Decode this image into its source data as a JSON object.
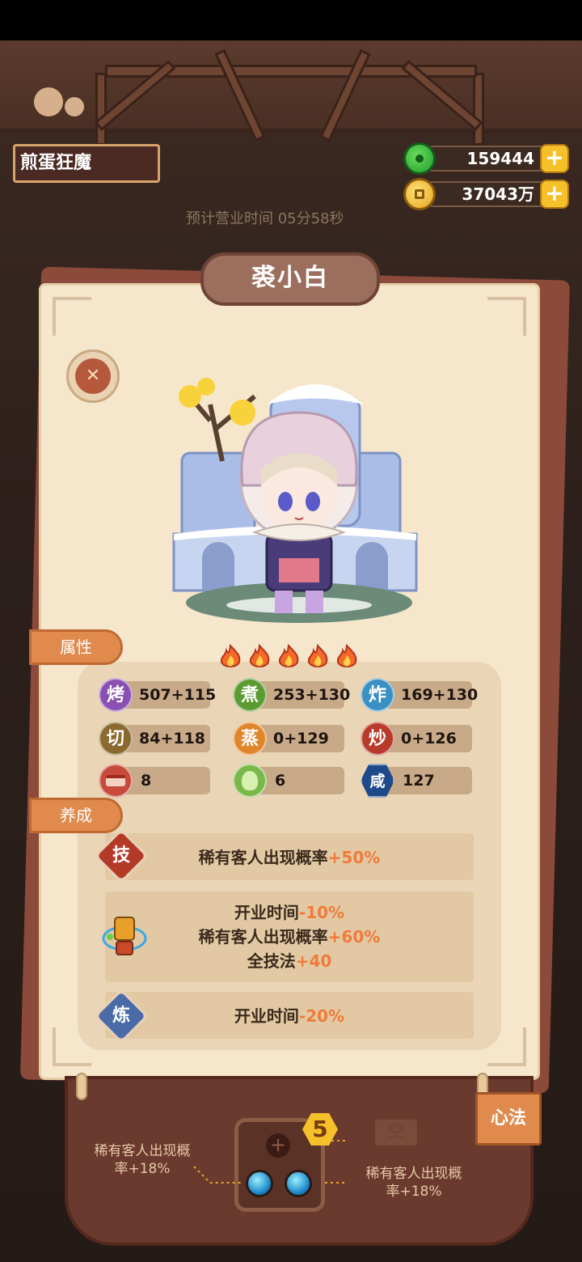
{
  "header": {
    "restaurant_name": "煎蛋狂魔",
    "jade_amount": "159444",
    "coin_amount": "37043万",
    "business_time": "预计营业时间 05分58秒"
  },
  "character": {
    "name": "裘小白",
    "stars": 5
  },
  "attributes_tab": "属性",
  "stats": [
    {
      "icon": "烤",
      "value": "507+115",
      "color": "#8a4fb2"
    },
    {
      "icon": "煮",
      "value": "253+130",
      "color": "#5c9a32"
    },
    {
      "icon": "炸",
      "value": "169+130",
      "color": "#3a90c2"
    },
    {
      "icon": "切",
      "value": "84+118",
      "color": "#8a6a2e"
    },
    {
      "icon": "蒸",
      "value": "0+129",
      "color": "#e0862a"
    },
    {
      "icon": "炒",
      "value": "0+126",
      "color": "#b83a2a"
    },
    {
      "icon": "meat",
      "value": "8",
      "color": "#c74a3a"
    },
    {
      "icon": "veg",
      "value": "6",
      "color": "#7ab84a"
    },
    {
      "icon": "咸",
      "value": "127",
      "color": "#1f4a8a"
    }
  ],
  "growth_tab": "养成",
  "skills": {
    "tech_icon": "技",
    "tech_text": "稀有客人出现概率",
    "tech_bonus": "+50%",
    "equip_line1_text": "开业时间",
    "equip_line1_bonus": "-10%",
    "equip_line2_text": "稀有客人出现概率",
    "equip_line2_bonus": "+60%",
    "equip_line3_text": "全技法",
    "equip_line3_bonus": "+40",
    "refine_icon": "炼",
    "refine_text": "开业时间",
    "refine_bonus": "-20%"
  },
  "bottom": {
    "xinfa_label": "心法",
    "level_badge": "5",
    "empty_label": "空",
    "left_bonus": "稀有客人出现概率+18%",
    "right_bonus": "稀有客人出现概率+18%"
  }
}
